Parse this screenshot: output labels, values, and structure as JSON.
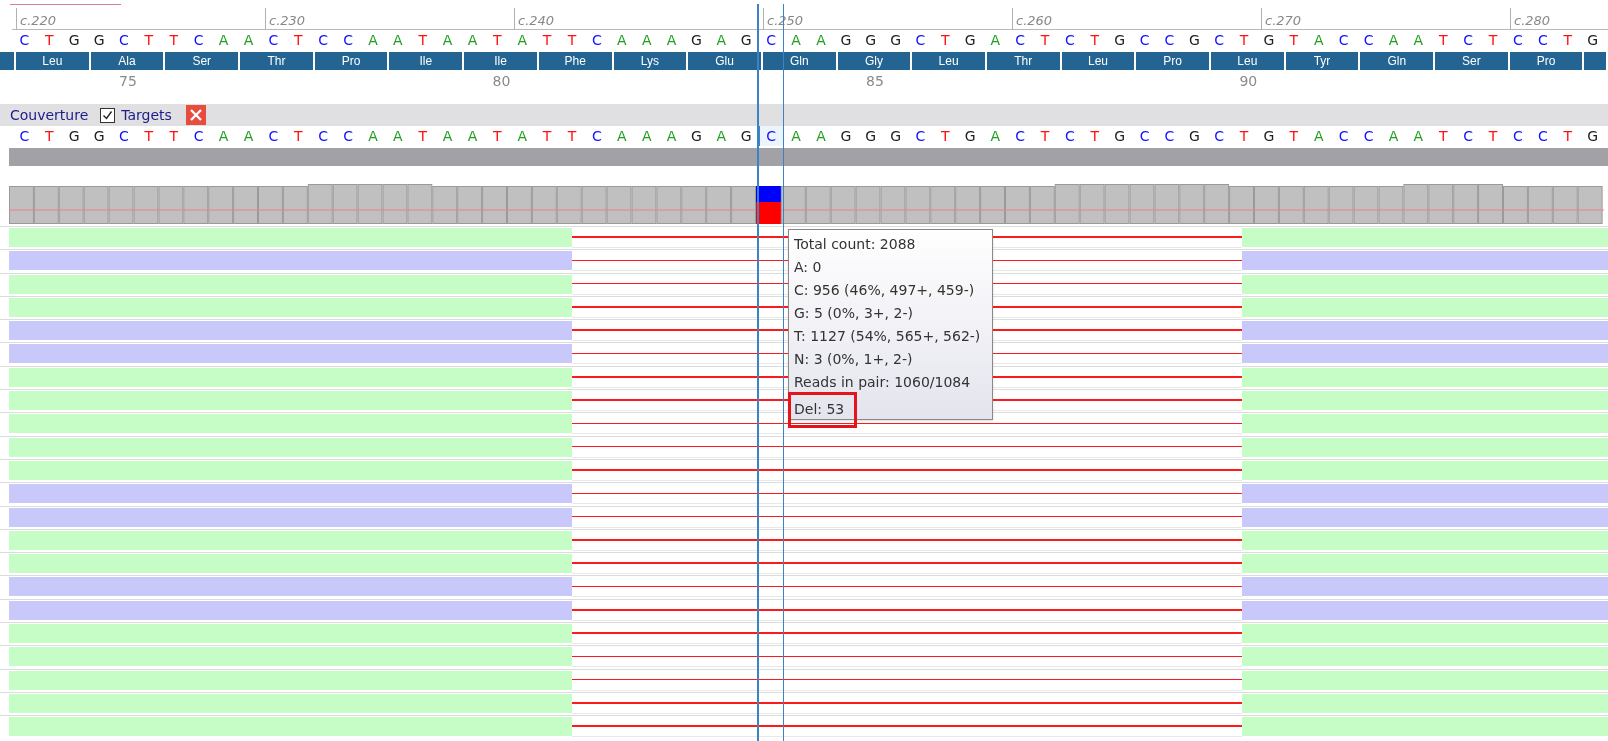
{
  "ruler": [
    "c.220",
    "c.230",
    "c.240",
    "c.250",
    "c.260",
    "c.270",
    "c.280"
  ],
  "reference": [
    {
      "b": "C",
      "color": "#1010ff"
    },
    {
      "b": "T",
      "color": "#ff1010"
    },
    {
      "b": "G",
      "color": "#202020"
    },
    {
      "b": "G",
      "color": "#202020"
    },
    {
      "b": "C",
      "color": "#1010ff"
    },
    {
      "b": "T",
      "color": "#ff1010"
    },
    {
      "b": "T",
      "color": "#ff1010"
    },
    {
      "b": "C",
      "color": "#1010ff"
    },
    {
      "b": "A",
      "color": "#22a022"
    },
    {
      "b": "A",
      "color": "#22a022"
    },
    {
      "b": "C",
      "color": "#1010ff"
    },
    {
      "b": "T",
      "color": "#ff1010"
    },
    {
      "b": "C",
      "color": "#1010ff"
    },
    {
      "b": "C",
      "color": "#1010ff"
    },
    {
      "b": "A",
      "color": "#22a022"
    },
    {
      "b": "A",
      "color": "#22a022"
    },
    {
      "b": "T",
      "color": "#ff1010"
    },
    {
      "b": "A",
      "color": "#22a022"
    },
    {
      "b": "A",
      "color": "#22a022"
    },
    {
      "b": "T",
      "color": "#ff1010"
    },
    {
      "b": "A",
      "color": "#22a022"
    },
    {
      "b": "T",
      "color": "#ff1010"
    },
    {
      "b": "T",
      "color": "#ff1010"
    },
    {
      "b": "C",
      "color": "#1010ff"
    },
    {
      "b": "A",
      "color": "#22a022"
    },
    {
      "b": "A",
      "color": "#22a022"
    },
    {
      "b": "A",
      "color": "#22a022"
    },
    {
      "b": "G",
      "color": "#202020"
    },
    {
      "b": "A",
      "color": "#22a022"
    },
    {
      "b": "G",
      "color": "#202020"
    },
    {
      "b": "C",
      "color": "#1010ff"
    },
    {
      "b": "A",
      "color": "#22a022"
    },
    {
      "b": "A",
      "color": "#22a022"
    },
    {
      "b": "G",
      "color": "#202020"
    },
    {
      "b": "G",
      "color": "#202020"
    },
    {
      "b": "G",
      "color": "#202020"
    },
    {
      "b": "C",
      "color": "#1010ff"
    },
    {
      "b": "T",
      "color": "#ff1010"
    },
    {
      "b": "G",
      "color": "#202020"
    },
    {
      "b": "A",
      "color": "#22a022"
    },
    {
      "b": "C",
      "color": "#1010ff"
    },
    {
      "b": "T",
      "color": "#ff1010"
    },
    {
      "b": "C",
      "color": "#1010ff"
    },
    {
      "b": "T",
      "color": "#ff1010"
    },
    {
      "b": "G",
      "color": "#202020"
    },
    {
      "b": "C",
      "color": "#1010ff"
    },
    {
      "b": "C",
      "color": "#1010ff"
    },
    {
      "b": "G",
      "color": "#202020"
    },
    {
      "b": "C",
      "color": "#1010ff"
    },
    {
      "b": "T",
      "color": "#ff1010"
    },
    {
      "b": "G",
      "color": "#202020"
    },
    {
      "b": "T",
      "color": "#ff1010"
    },
    {
      "b": "A",
      "color": "#22a022"
    },
    {
      "b": "C",
      "color": "#1010ff"
    },
    {
      "b": "C",
      "color": "#1010ff"
    },
    {
      "b": "A",
      "color": "#22a022"
    },
    {
      "b": "A",
      "color": "#22a022"
    },
    {
      "b": "T",
      "color": "#ff1010"
    },
    {
      "b": "C",
      "color": "#1010ff"
    },
    {
      "b": "T",
      "color": "#ff1010"
    },
    {
      "b": "C",
      "color": "#1010ff"
    },
    {
      "b": "C",
      "color": "#1010ff"
    },
    {
      "b": "T",
      "color": "#ff1010"
    },
    {
      "b": "G",
      "color": "#202020"
    }
  ],
  "amino_acids": [
    {
      "kind": "partial"
    },
    {
      "kind": "codon",
      "name": "Leu"
    },
    {
      "kind": "codon",
      "name": "Ala",
      "number": "75"
    },
    {
      "kind": "codon",
      "name": "Ser"
    },
    {
      "kind": "codon",
      "name": "Thr"
    },
    {
      "kind": "codon",
      "name": "Pro"
    },
    {
      "kind": "codon",
      "name": "Ile"
    },
    {
      "kind": "codon",
      "name": "Ile",
      "number": "80"
    },
    {
      "kind": "codon",
      "name": "Phe"
    },
    {
      "kind": "codon",
      "name": "Lys"
    },
    {
      "kind": "codon",
      "name": "Glu"
    },
    {
      "kind": "codon",
      "name": "Gln"
    },
    {
      "kind": "codon",
      "name": "Gly",
      "number": "85"
    },
    {
      "kind": "codon",
      "name": "Leu"
    },
    {
      "kind": "codon",
      "name": "Thr"
    },
    {
      "kind": "codon",
      "name": "Leu"
    },
    {
      "kind": "codon",
      "name": "Pro"
    },
    {
      "kind": "codon",
      "name": "Leu",
      "number": "90"
    },
    {
      "kind": "codon",
      "name": "Tyr"
    },
    {
      "kind": "codon",
      "name": "Gln"
    },
    {
      "kind": "codon",
      "name": "Ser"
    },
    {
      "kind": "codon",
      "name": "Pro"
    },
    {
      "kind": "partial"
    }
  ],
  "track_header": {
    "title": "Couverture",
    "targets": {
      "label": "Targets",
      "checked": true
    }
  },
  "coverage_sequence": [
    {
      "b": "C",
      "color": "#1010ff",
      "selected": false
    },
    {
      "b": "T",
      "color": "#ff1010",
      "selected": false
    },
    {
      "b": "G",
      "color": "#202020",
      "selected": false
    },
    {
      "b": "G",
      "color": "#202020",
      "selected": false
    },
    {
      "b": "C",
      "color": "#1010ff",
      "selected": false
    },
    {
      "b": "T",
      "color": "#ff1010",
      "selected": false
    },
    {
      "b": "T",
      "color": "#ff1010",
      "selected": false
    },
    {
      "b": "C",
      "color": "#1010ff",
      "selected": false
    },
    {
      "b": "A",
      "color": "#22a022",
      "selected": false
    },
    {
      "b": "A",
      "color": "#22a022",
      "selected": false
    },
    {
      "b": "C",
      "color": "#1010ff",
      "selected": false
    },
    {
      "b": "T",
      "color": "#ff1010",
      "selected": false
    },
    {
      "b": "C",
      "color": "#1010ff",
      "selected": false
    },
    {
      "b": "C",
      "color": "#1010ff",
      "selected": false
    },
    {
      "b": "A",
      "color": "#22a022",
      "selected": false
    },
    {
      "b": "A",
      "color": "#22a022",
      "selected": false
    },
    {
      "b": "T",
      "color": "#ff1010",
      "selected": false
    },
    {
      "b": "A",
      "color": "#22a022",
      "selected": false
    },
    {
      "b": "A",
      "color": "#22a022",
      "selected": false
    },
    {
      "b": "T",
      "color": "#ff1010",
      "selected": false
    },
    {
      "b": "A",
      "color": "#22a022",
      "selected": false
    },
    {
      "b": "T",
      "color": "#ff1010",
      "selected": false
    },
    {
      "b": "T",
      "color": "#ff1010",
      "selected": false
    },
    {
      "b": "C",
      "color": "#1010ff",
      "selected": false
    },
    {
      "b": "A",
      "color": "#22a022",
      "selected": false
    },
    {
      "b": "A",
      "color": "#22a022",
      "selected": false
    },
    {
      "b": "A",
      "color": "#22a022",
      "selected": false
    },
    {
      "b": "G",
      "color": "#202020",
      "selected": false
    },
    {
      "b": "A",
      "color": "#22a022",
      "selected": false
    },
    {
      "b": "G",
      "color": "#202020",
      "selected": false
    },
    {
      "b": "C",
      "color": "#1010ff",
      "selected": true
    },
    {
      "b": "A",
      "color": "#22a022",
      "selected": false
    },
    {
      "b": "A",
      "color": "#22a022",
      "selected": false
    },
    {
      "b": "G",
      "color": "#202020",
      "selected": false
    },
    {
      "b": "G",
      "color": "#202020",
      "selected": false
    },
    {
      "b": "G",
      "color": "#202020",
      "selected": false
    },
    {
      "b": "C",
      "color": "#1010ff",
      "selected": false
    },
    {
      "b": "T",
      "color": "#ff1010",
      "selected": false
    },
    {
      "b": "G",
      "color": "#202020",
      "selected": false
    },
    {
      "b": "A",
      "color": "#22a022",
      "selected": false
    },
    {
      "b": "C",
      "color": "#1010ff",
      "selected": false
    },
    {
      "b": "T",
      "color": "#ff1010",
      "selected": false
    },
    {
      "b": "C",
      "color": "#1010ff",
      "selected": false
    },
    {
      "b": "T",
      "color": "#ff1010",
      "selected": false
    },
    {
      "b": "G",
      "color": "#202020",
      "selected": false
    },
    {
      "b": "C",
      "color": "#1010ff",
      "selected": false
    },
    {
      "b": "C",
      "color": "#1010ff",
      "selected": false
    },
    {
      "b": "G",
      "color": "#202020",
      "selected": false
    },
    {
      "b": "C",
      "color": "#1010ff",
      "selected": false
    },
    {
      "b": "T",
      "color": "#ff1010",
      "selected": false
    },
    {
      "b": "G",
      "color": "#202020",
      "selected": false
    },
    {
      "b": "T",
      "color": "#ff1010",
      "selected": false
    },
    {
      "b": "A",
      "color": "#22a022",
      "selected": false
    },
    {
      "b": "C",
      "color": "#1010ff",
      "selected": false
    },
    {
      "b": "C",
      "color": "#1010ff",
      "selected": false
    },
    {
      "b": "A",
      "color": "#22a022",
      "selected": false
    },
    {
      "b": "A",
      "color": "#22a022",
      "selected": false
    },
    {
      "b": "T",
      "color": "#ff1010",
      "selected": false
    },
    {
      "b": "C",
      "color": "#1010ff",
      "selected": false
    },
    {
      "b": "T",
      "color": "#ff1010",
      "selected": false
    },
    {
      "b": "C",
      "color": "#1010ff",
      "selected": false
    },
    {
      "b": "C",
      "color": "#1010ff",
      "selected": false
    },
    {
      "b": "T",
      "color": "#ff1010",
      "selected": false
    },
    {
      "b": "G",
      "color": "#202020",
      "selected": false
    }
  ],
  "reads": [
    {
      "color": "#c6fcc6"
    },
    {
      "color": "#c8c8fa"
    },
    {
      "color": "#c6fcc6"
    },
    {
      "color": "#c6fcc6"
    },
    {
      "color": "#c8c8fa"
    },
    {
      "color": "#c8c8fa"
    },
    {
      "color": "#c6fcc6"
    },
    {
      "color": "#c6fcc6"
    },
    {
      "color": "#c6fcc6"
    },
    {
      "color": "#c6fcc6"
    },
    {
      "color": "#c6fcc6"
    },
    {
      "color": "#c8c8fa"
    },
    {
      "color": "#c8c8fa"
    },
    {
      "color": "#c6fcc6"
    },
    {
      "color": "#c6fcc6"
    },
    {
      "color": "#c8c8fa"
    },
    {
      "color": "#c8c8fa"
    },
    {
      "color": "#c6fcc6"
    },
    {
      "color": "#c6fcc6"
    },
    {
      "color": "#c6fcc6"
    },
    {
      "color": "#c6fcc6"
    },
    {
      "color": "#c6fcc6"
    }
  ],
  "tooltip": {
    "lines": [
      {
        "text": "Total count: 2088",
        "highlighted": false
      },
      {
        "text": "A: 0",
        "highlighted": false
      },
      {
        "text": "C: 956 (46%, 497+, 459-)",
        "highlighted": false
      },
      {
        "text": "G: 5 (0%, 3+, 2-)",
        "highlighted": false
      },
      {
        "text": "T: 1127 (54%, 565+, 562-)",
        "highlighted": false
      },
      {
        "text": "N: 3 (0%, 1+, 2-)",
        "highlighted": false
      },
      {
        "text": "Reads in pair: 1060/1084",
        "highlighted": false
      },
      {
        "text": "Del: 53",
        "highlighted": true
      }
    ]
  }
}
